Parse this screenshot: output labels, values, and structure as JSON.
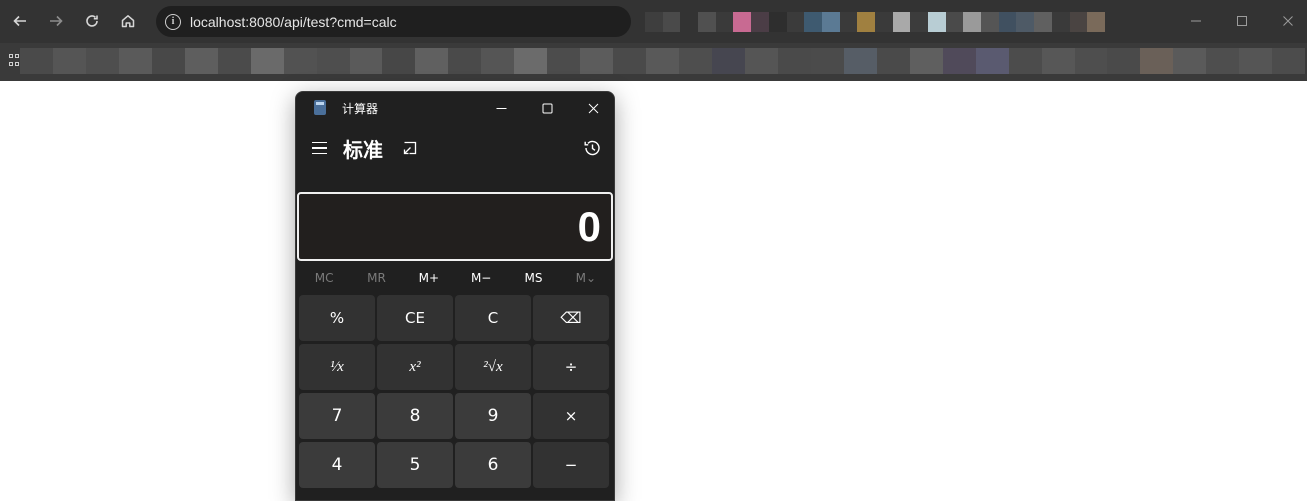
{
  "browser": {
    "url": "localhost:8080/api/test?cmd=calc",
    "icons": {
      "back": "arrow-left-icon",
      "forward": "arrow-right-icon",
      "reload": "reload-icon",
      "home": "home-icon",
      "site_info": "info-icon",
      "apps": "apps-grid-icon"
    },
    "colors": {
      "toolbar": "#333333",
      "omnibox": "#1f1f1f",
      "bookmarks_bar": "#3a3a3a"
    }
  },
  "calculator": {
    "window_title": "计算器",
    "mode_title": "标准",
    "display_value": "0",
    "memory_buttons": [
      {
        "label": "MC",
        "enabled": false
      },
      {
        "label": "MR",
        "enabled": false
      },
      {
        "label": "M+",
        "enabled": true
      },
      {
        "label": "M−",
        "enabled": true
      },
      {
        "label": "MS",
        "enabled": true
      },
      {
        "label": "M⌄",
        "enabled": false
      }
    ],
    "keys": [
      {
        "label": "%",
        "name": "percent-key",
        "kind": "fn"
      },
      {
        "label": "CE",
        "name": "clear-entry-key",
        "kind": "fn"
      },
      {
        "label": "C",
        "name": "clear-key",
        "kind": "fn"
      },
      {
        "label": "⌫",
        "name": "backspace-key",
        "kind": "fn"
      },
      {
        "label": "¹⁄x",
        "name": "reciprocal-key",
        "kind": "serif"
      },
      {
        "label": "x²",
        "name": "square-key",
        "kind": "serif"
      },
      {
        "label": "²√x",
        "name": "square-root-key",
        "kind": "serif"
      },
      {
        "label": "÷",
        "name": "divide-key",
        "kind": "fn"
      },
      {
        "label": "7",
        "name": "digit-7-key",
        "kind": "num"
      },
      {
        "label": "8",
        "name": "digit-8-key",
        "kind": "num"
      },
      {
        "label": "9",
        "name": "digit-9-key",
        "kind": "num"
      },
      {
        "label": "×",
        "name": "multiply-key",
        "kind": "fn"
      },
      {
        "label": "4",
        "name": "digit-4-key",
        "kind": "num"
      },
      {
        "label": "5",
        "name": "digit-5-key",
        "kind": "num"
      },
      {
        "label": "6",
        "name": "digit-6-key",
        "kind": "num"
      },
      {
        "label": "−",
        "name": "subtract-key",
        "kind": "fn"
      }
    ],
    "colors": {
      "background": "#202020",
      "display_border": "#f0f0f0",
      "key": "#323232",
      "num_key": "#3b3b3b"
    }
  }
}
